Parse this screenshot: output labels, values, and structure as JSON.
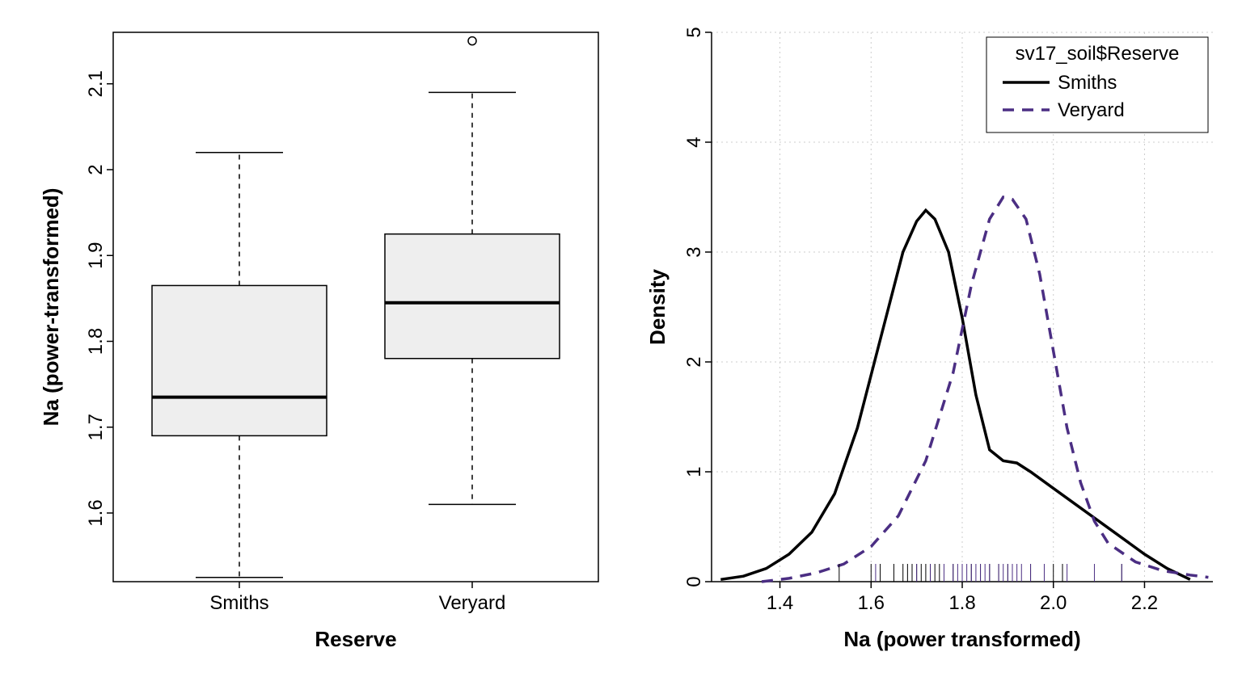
{
  "chart_data": [
    {
      "type": "boxplot",
      "xlabel": "Reserve",
      "ylabel": "Na (power-transformed)",
      "categories": [
        "Smiths",
        "Veryard"
      ],
      "ylim": [
        1.52,
        2.16
      ],
      "yticks": [
        1.6,
        1.7,
        1.8,
        1.9,
        2.0,
        2.1
      ],
      "boxes": [
        {
          "name": "Smiths",
          "lower_whisker": 1.525,
          "q1": 1.69,
          "median": 1.735,
          "q3": 1.865,
          "upper_whisker": 2.02,
          "outliers": []
        },
        {
          "name": "Veryard",
          "lower_whisker": 1.61,
          "q1": 1.78,
          "median": 1.845,
          "q3": 1.925,
          "upper_whisker": 2.09,
          "outliers": [
            2.15
          ]
        }
      ]
    },
    {
      "type": "density",
      "xlabel": "Na (power transformed)",
      "ylabel": "Density",
      "xlim": [
        1.25,
        2.35
      ],
      "ylim": [
        0,
        5
      ],
      "xticks": [
        1.4,
        1.6,
        1.8,
        2.0,
        2.2
      ],
      "yticks": [
        0,
        1,
        2,
        3,
        4,
        5
      ],
      "grid": true,
      "legend": {
        "title": "sv17_soil$Reserve",
        "items": [
          {
            "name": "Smiths",
            "linestyle": "solid",
            "color": "#000000"
          },
          {
            "name": "Veryard",
            "linestyle": "dashed",
            "color": "#4b2e83"
          }
        ],
        "position": "topright"
      },
      "series": [
        {
          "name": "Smiths",
          "x": [
            1.27,
            1.32,
            1.37,
            1.42,
            1.47,
            1.52,
            1.57,
            1.62,
            1.67,
            1.7,
            1.72,
            1.74,
            1.77,
            1.8,
            1.83,
            1.86,
            1.89,
            1.92,
            1.95,
            2.0,
            2.05,
            2.1,
            2.15,
            2.2,
            2.25,
            2.3
          ],
          "y": [
            0.02,
            0.05,
            0.12,
            0.25,
            0.45,
            0.8,
            1.4,
            2.2,
            3.0,
            3.28,
            3.38,
            3.3,
            3.0,
            2.4,
            1.7,
            1.2,
            1.1,
            1.08,
            1.0,
            0.85,
            0.7,
            0.55,
            0.4,
            0.25,
            0.12,
            0.02
          ]
        },
        {
          "name": "Veryard",
          "x": [
            1.36,
            1.42,
            1.48,
            1.54,
            1.6,
            1.66,
            1.72,
            1.78,
            1.82,
            1.86,
            1.89,
            1.91,
            1.94,
            1.97,
            2.0,
            2.03,
            2.06,
            2.09,
            2.12,
            2.18,
            2.24,
            2.3,
            2.34
          ],
          "y": [
            0.0,
            0.03,
            0.08,
            0.16,
            0.32,
            0.6,
            1.1,
            1.9,
            2.7,
            3.3,
            3.5,
            3.48,
            3.3,
            2.8,
            2.1,
            1.4,
            0.9,
            0.55,
            0.35,
            0.18,
            0.1,
            0.06,
            0.04
          ]
        }
      ],
      "rug": {
        "Smiths": [
          1.53,
          1.6,
          1.62,
          1.65,
          1.67,
          1.68,
          1.69,
          1.7,
          1.71,
          1.72,
          1.73,
          1.74,
          1.75,
          1.78,
          1.8,
          1.82,
          1.84,
          1.86,
          1.88,
          1.9,
          1.95,
          2.0,
          2.02,
          2.15
        ],
        "Veryard": [
          1.61,
          1.7,
          1.73,
          1.76,
          1.78,
          1.79,
          1.8,
          1.81,
          1.82,
          1.83,
          1.84,
          1.85,
          1.86,
          1.88,
          1.89,
          1.9,
          1.91,
          1.92,
          1.93,
          1.95,
          1.98,
          2.03,
          2.09,
          2.15
        ]
      }
    }
  ]
}
